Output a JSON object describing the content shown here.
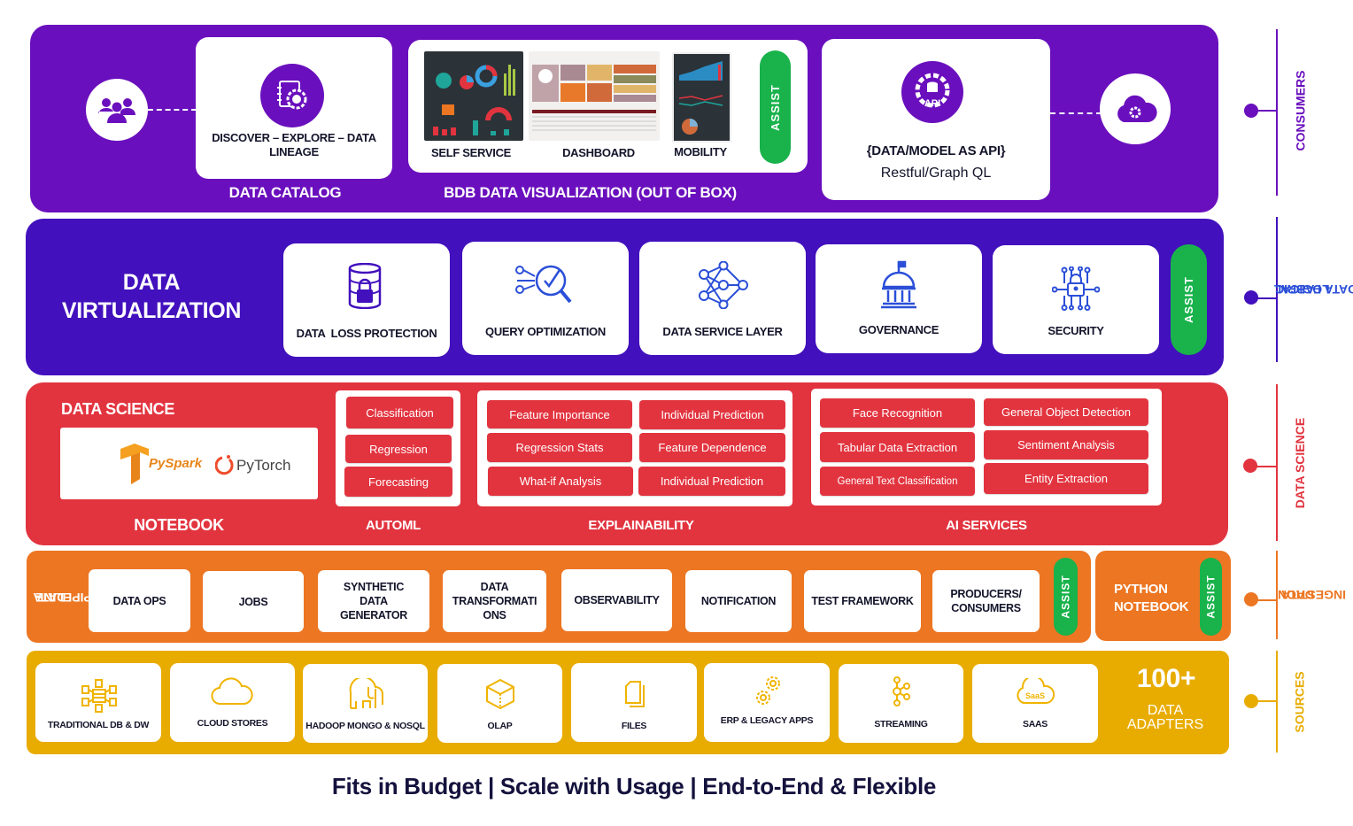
{
  "colors": {
    "consumers": "#6a0fbd",
    "logical": "#4210bd",
    "data_science": "#e2343f",
    "ingestion": "#ec7622",
    "sources": "#e8ac00",
    "assist": "#19b24b",
    "footer_text": "#14123d"
  },
  "consumers": {
    "side_label": "CONSUMERS",
    "users_icon": "users-icon",
    "catalog": {
      "card_text": "DISCOVER – EXPLORE – DATA LINEAGE",
      "title": "DATA CATALOG",
      "icon": "catalog-gear-icon"
    },
    "visualization": {
      "items": [
        "SELF SERVICE",
        "DASHBOARD",
        "MOBILITY"
      ],
      "assist": "ASSIST",
      "title": "BDB DATA VISUALIZATION (OUT OF BOX)"
    },
    "api": {
      "icon": "api-gear-icon",
      "icon_text": "API",
      "title": "{DATA/MODEL AS API}",
      "subtitle": "Restful/Graph QL"
    },
    "cloud_icon": "cloud-gear-icon"
  },
  "logical": {
    "side_label_line1": "LOGICAL",
    "side_label_line2": "DATA FABRIC",
    "title_line1": "DATA",
    "title_line2": "VIRTUALIZATION",
    "cards": [
      {
        "label": "DATA  LOSS PROTECTION",
        "icon": "database-lock-icon"
      },
      {
        "label": "QUERY OPTIMIZATION",
        "icon": "query-search-icon"
      },
      {
        "label": "DATA SERVICE LAYER",
        "icon": "network-nodes-icon"
      },
      {
        "label": "GOVERNANCE",
        "icon": "capitol-building-icon"
      },
      {
        "label": "SECURITY",
        "icon": "circuit-lock-icon"
      }
    ],
    "assist": "ASSIST"
  },
  "data_science": {
    "side_label": "DATA SCIENCE",
    "title": "DATA SCIENCE",
    "notebook": {
      "label": "NOTEBOOK",
      "logos": [
        "PySpark",
        "PyTorch"
      ]
    },
    "automl": {
      "label": "AUTOML",
      "items": [
        "Classification",
        "Regression",
        "Forecasting"
      ]
    },
    "explainability": {
      "label": "EXPLAINABILITY",
      "items": [
        "Feature Importance",
        "Individual Prediction",
        "Regression Stats",
        "Feature Dependence",
        "What-if Analysis",
        "Individual Prediction"
      ]
    },
    "ai_services": {
      "label": "AI SERVICES",
      "items": [
        "Face Recognition",
        "General Object Detection",
        "Tabular Data Extraction",
        "Sentiment Analysis",
        "General Text Classification",
        "Entity Extraction"
      ]
    }
  },
  "ingestion": {
    "side_label_line1": "DATA",
    "side_label_line2": "INGESTION",
    "pipeline_label_line1": "DATA",
    "pipeline_label_line2": "PIPELINE",
    "cards": [
      "DATA OPS",
      "JOBS",
      "SYNTHETIC DATA GENERATOR",
      "DATA TRANSFORMATI ONS",
      "OBSERVABILITY",
      "NOTIFICATION",
      "TEST FRAMEWORK",
      "PRODUCERS/ CONSUMERS"
    ],
    "assist": "ASSIST",
    "python_notebook": "PYTHON NOTEBOOK",
    "python_assist": "ASSIST"
  },
  "sources": {
    "side_label": "SOURCES",
    "cards": [
      {
        "label": "TRADITIONAL DB & DW",
        "icon": "db-network-icon"
      },
      {
        "label": "CLOUD STORES",
        "icon": "cloud-icon"
      },
      {
        "label": "HADOOP MONGO & NOSQL",
        "icon": "elephant-icon"
      },
      {
        "label": "OLAP",
        "icon": "cube-icon"
      },
      {
        "label": "FILES",
        "icon": "files-icon"
      },
      {
        "label": "ERP & LEGACY APPS",
        "icon": "gears-icon"
      },
      {
        "label": "STREAMING",
        "icon": "stream-nodes-icon"
      },
      {
        "label": "SAAS",
        "icon": "saas-cloud-icon"
      }
    ],
    "adapters_count": "100+",
    "adapters_label": "DATA ADAPTERS"
  },
  "footer": {
    "tagline": "Fits in Budget | Scale with Usage | End-to-End & Flexible"
  }
}
